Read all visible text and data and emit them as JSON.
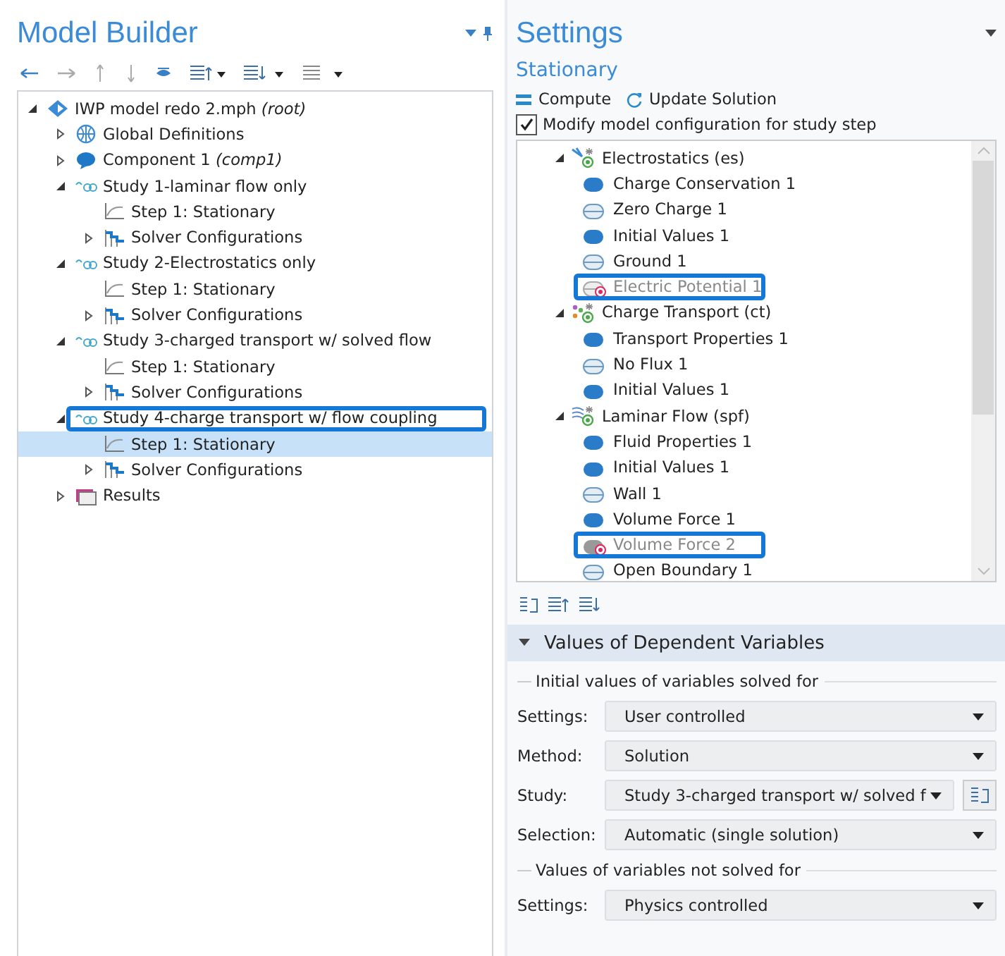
{
  "model_builder": {
    "title": "Model Builder",
    "tree": [
      {
        "label": "IWP model redo 2.mph  *(root)*",
        "kind": "root",
        "expanded": true,
        "selected": false,
        "annotated": false,
        "children": [
          {
            "label": "Global Definitions",
            "kind": "globe",
            "expanded": false,
            "selected": false,
            "annotated": false
          },
          {
            "label": "Component 1  *(comp1)*",
            "kind": "component",
            "expanded": false,
            "selected": false,
            "annotated": false
          },
          {
            "label": "Study 1-laminar flow only",
            "kind": "study",
            "expanded": true,
            "selected": false,
            "annotated": false,
            "children": [
              {
                "label": "Step 1: Stationary",
                "kind": "step",
                "selected": false,
                "annotated": false
              },
              {
                "label": "Solver Configurations",
                "kind": "solver",
                "expanded": false,
                "selected": false,
                "annotated": false
              }
            ]
          },
          {
            "label": "Study 2-Electrostatics only",
            "kind": "study",
            "expanded": true,
            "selected": false,
            "annotated": false,
            "children": [
              {
                "label": "Step 1: Stationary",
                "kind": "step",
                "selected": false,
                "annotated": false
              },
              {
                "label": "Solver Configurations",
                "kind": "solver",
                "expanded": false,
                "selected": false,
                "annotated": false
              }
            ]
          },
          {
            "label": "Study 3-charged transport w/ solved flow",
            "kind": "study",
            "expanded": true,
            "selected": false,
            "annotated": false,
            "children": [
              {
                "label": "Step 1: Stationary",
                "kind": "step",
                "selected": false,
                "annotated": false
              },
              {
                "label": "Solver Configurations",
                "kind": "solver",
                "expanded": false,
                "selected": false,
                "annotated": false
              }
            ]
          },
          {
            "label": "Study 4-charge transport w/ flow coupling",
            "kind": "study",
            "expanded": true,
            "selected": false,
            "annotated": true,
            "children": [
              {
                "label": "Step 1: Stationary",
                "kind": "step",
                "selected": true,
                "annotated": false
              },
              {
                "label": "Solver Configurations",
                "kind": "solver",
                "expanded": false,
                "selected": false,
                "annotated": false
              }
            ]
          },
          {
            "label": "Results",
            "kind": "results",
            "expanded": false,
            "selected": false,
            "annotated": false
          }
        ]
      }
    ]
  },
  "settings": {
    "title": "Settings",
    "subtitle": "Stationary",
    "actions": [
      {
        "label": "Compute",
        "kind": "compute"
      },
      {
        "label": "Update Solution",
        "kind": "update"
      }
    ],
    "modify_checkbox": {
      "label": "Modify model configuration for study step",
      "checked": true
    },
    "physics": [
      {
        "label": "Electrostatics (es)",
        "kind": "es",
        "expanded": true,
        "children": [
          {
            "label": "Charge Conservation 1",
            "kind": "domain",
            "disabled": false,
            "annotated": false
          },
          {
            "label": "Zero Charge 1",
            "kind": "boundary",
            "disabled": false,
            "annotated": false
          },
          {
            "label": "Initial Values 1",
            "kind": "domain",
            "disabled": false,
            "annotated": false
          },
          {
            "label": "Ground 1",
            "kind": "boundary",
            "disabled": false,
            "annotated": false
          },
          {
            "label": "Electric Potential 1",
            "kind": "boundary",
            "disabled": true,
            "annotated": true
          }
        ]
      },
      {
        "label": "Charge Transport (ct)",
        "kind": "ct",
        "expanded": true,
        "children": [
          {
            "label": "Transport Properties 1",
            "kind": "domain",
            "disabled": false,
            "annotated": false
          },
          {
            "label": "No Flux 1",
            "kind": "boundary",
            "disabled": false,
            "annotated": false
          },
          {
            "label": "Initial Values 1",
            "kind": "domain",
            "disabled": false,
            "annotated": false
          }
        ]
      },
      {
        "label": "Laminar Flow (spf)",
        "kind": "spf",
        "expanded": true,
        "children": [
          {
            "label": "Fluid Properties 1",
            "kind": "domain",
            "disabled": false,
            "annotated": false
          },
          {
            "label": "Initial Values 1",
            "kind": "domain",
            "disabled": false,
            "annotated": false
          },
          {
            "label": "Wall 1",
            "kind": "boundary",
            "disabled": false,
            "annotated": false
          },
          {
            "label": "Volume Force 1",
            "kind": "domain",
            "disabled": false,
            "annotated": false
          },
          {
            "label": "Volume Force 2",
            "kind": "domain",
            "disabled": true,
            "annotated": true
          },
          {
            "label": "Open Boundary 1",
            "kind": "boundary",
            "disabled": false,
            "annotated": false
          }
        ]
      }
    ],
    "section": {
      "title": "Values of Dependent Variables",
      "expanded": true
    },
    "form": [
      {
        "kind": "heading",
        "text": "Initial values of variables solved for"
      },
      {
        "kind": "select",
        "label": "Settings:",
        "value": "User controlled"
      },
      {
        "kind": "select",
        "label": "Method:",
        "value": "Solution"
      },
      {
        "kind": "select_button",
        "label": "Study:",
        "value": "Study 3-charged transport w/ solved f"
      },
      {
        "kind": "select",
        "label": "Selection:",
        "value": "Automatic (single solution)"
      },
      {
        "kind": "heading",
        "text": "Values of variables not solved for"
      },
      {
        "kind": "select",
        "label": "Settings:",
        "value": "Physics controlled"
      }
    ]
  }
}
